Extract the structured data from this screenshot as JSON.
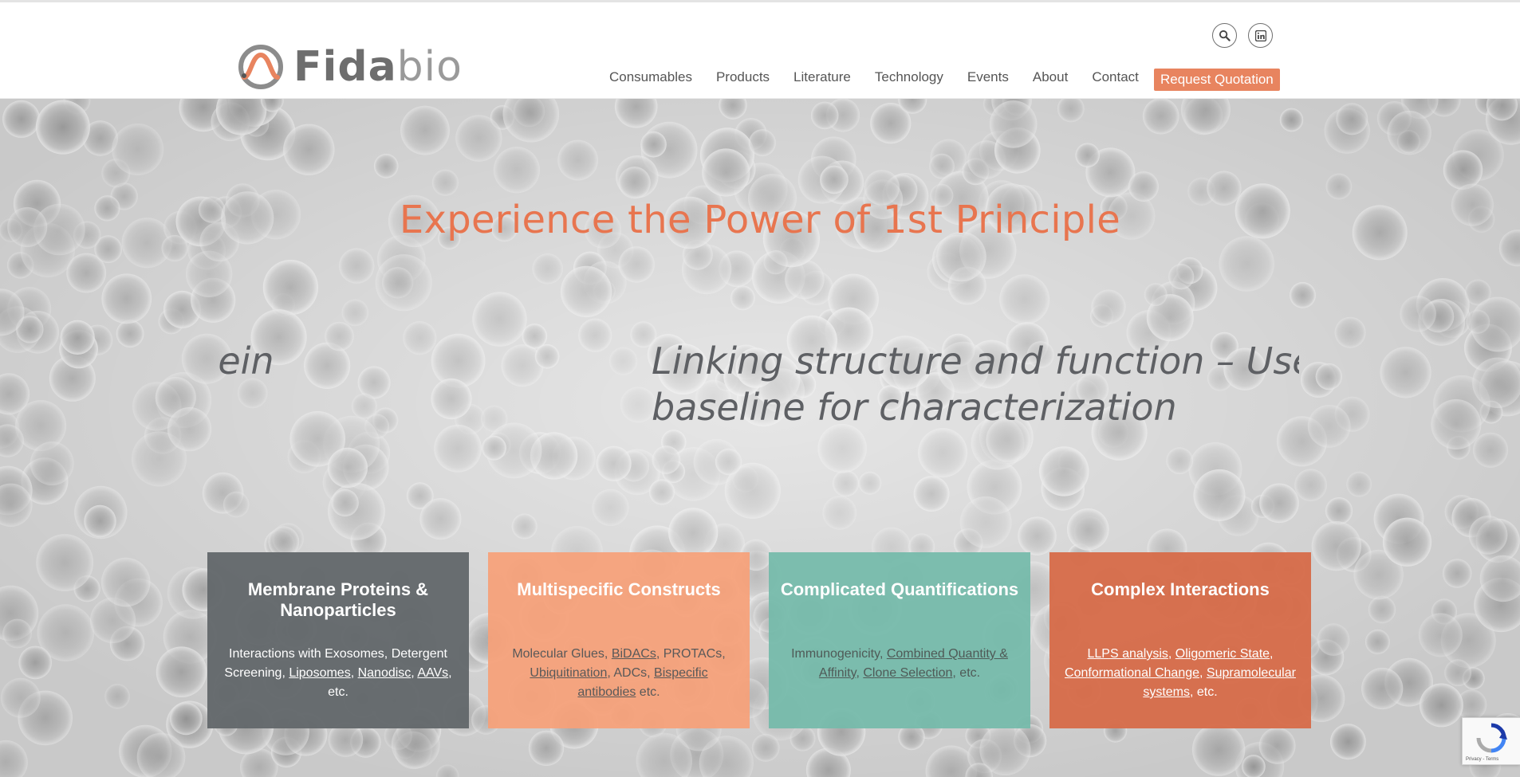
{
  "brand": {
    "name_part1": "Fida",
    "name_part2": "bio",
    "colors": {
      "accent": "#e8754f",
      "quote_button": "#e8845f",
      "logo_gray": "#6e6e6e"
    }
  },
  "header": {
    "icons": [
      "search-icon",
      "linkedin-icon"
    ],
    "nav": [
      "Consumables",
      "Products",
      "Literature",
      "Technology",
      "Events",
      "About",
      "Contact"
    ],
    "cta": "Request Quotation"
  },
  "hero": {
    "headline": "Experience the Power of 1st Principle",
    "slides": [
      {
        "lines": [
          "erization of protein",
          ""
        ]
      },
      {
        "lines": [
          "Linking structure and function – Use I",
          "baseline for characterization"
        ]
      }
    ]
  },
  "cards": [
    {
      "title": "Membrane Proteins & Nanoparticles",
      "body": [
        {
          "text": "Interactions with Exosomes, Detergent Screening, "
        },
        {
          "text": "Liposomes",
          "link": true
        },
        {
          "text": ", "
        },
        {
          "text": "Nanodisc",
          "link": true
        },
        {
          "text": ", "
        },
        {
          "text": "AAVs",
          "link": true
        },
        {
          "text": ", etc."
        }
      ],
      "color": "#63686b"
    },
    {
      "title": "Multispecific Constructs",
      "body": [
        {
          "text": "Molecular Glues, "
        },
        {
          "text": "BiDACs",
          "link": true
        },
        {
          "text": ", PROTACs, "
        },
        {
          "text": "Ubiquitination",
          "link": true
        },
        {
          "text": ", ADCs, "
        },
        {
          "text": "Bispecific antibodies",
          "link": true
        },
        {
          "text": " etc."
        }
      ],
      "color": "#f6a079"
    },
    {
      "title": "Complicated Quantifications",
      "body": [
        {
          "text": "Immunogenicity, "
        },
        {
          "text": "Combined Quantity & Affinity",
          "link": true
        },
        {
          "text": ", "
        },
        {
          "text": "Clone Selection",
          "link": true
        },
        {
          "text": ", etc."
        }
      ],
      "color": "#74baaa"
    },
    {
      "title": "Complex Interactions",
      "body": [
        {
          "text": "LLPS analysis",
          "link": true
        },
        {
          "text": ", "
        },
        {
          "text": "Oligomeric State",
          "link": true
        },
        {
          "text": ", "
        },
        {
          "text": "Conformational Change",
          "link": true
        },
        {
          "text": ", "
        },
        {
          "text": "Supramolecular systems",
          "link": true
        },
        {
          "text": ", etc."
        }
      ],
      "color": "#d66c4a"
    }
  ],
  "recaptcha": {
    "label": "Privacy - Terms"
  }
}
